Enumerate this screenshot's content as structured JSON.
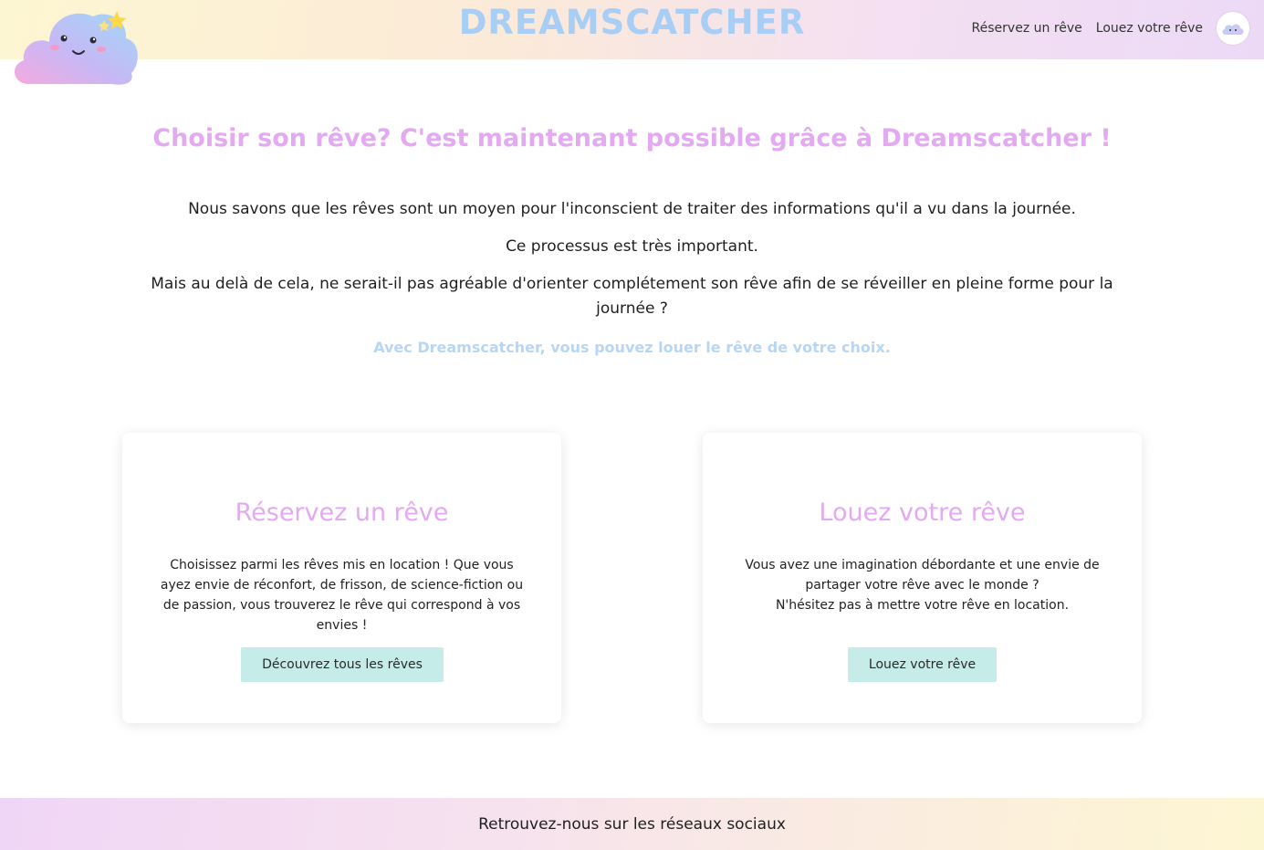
{
  "header": {
    "brand": "DREAMSCATCHER",
    "nav": [
      {
        "label": "Réservez un rêve"
      },
      {
        "label": "Louez votre rêve"
      }
    ]
  },
  "main": {
    "headline": "Choisir son rêve? C'est maintenant possible grâce à Dreamscatcher !",
    "paragraphs": [
      "Nous savons que les rêves sont un moyen pour l'inconscient de traiter des informations qu'il a vu dans la journée.",
      "Ce processus est très important.",
      "Mais au delà de cela, ne serait-il pas agréable d'orienter complétement son rêve afin de se réveiller en pleine forme pour la journée ?"
    ],
    "tagline": "Avec Dreamscatcher, vous pouvez louer le rêve de votre choix."
  },
  "cards": [
    {
      "title": "Réservez un rêve",
      "description": "Choisissez parmi les rêves mis en location ! Que vous ayez envie de réconfort, de frisson, de science-fiction ou de passion, vous trouverez le rêve qui correspond à vos envies !",
      "button": "Découvrez tous les rêves"
    },
    {
      "title": "Louez votre rêve",
      "description_line1": "Vous avez une imagination débordante et une envie de partager votre rêve avec le monde ?",
      "description_line2": "N'hésitez pas à mettre votre rêve en location.",
      "button": "Louez votre rêve"
    }
  ],
  "footer": {
    "text": "Retrouvez-nous sur les réseaux sociaux"
  },
  "colors": {
    "brand": "#a8cef6",
    "accent_pink": "#e3a9f1",
    "tagline_blue": "#b7d6f5",
    "button_bg": "#c6ecea"
  },
  "icons": {
    "logo": "cloud-mascot-logo",
    "avatar": "cloud-avatar-icon"
  }
}
